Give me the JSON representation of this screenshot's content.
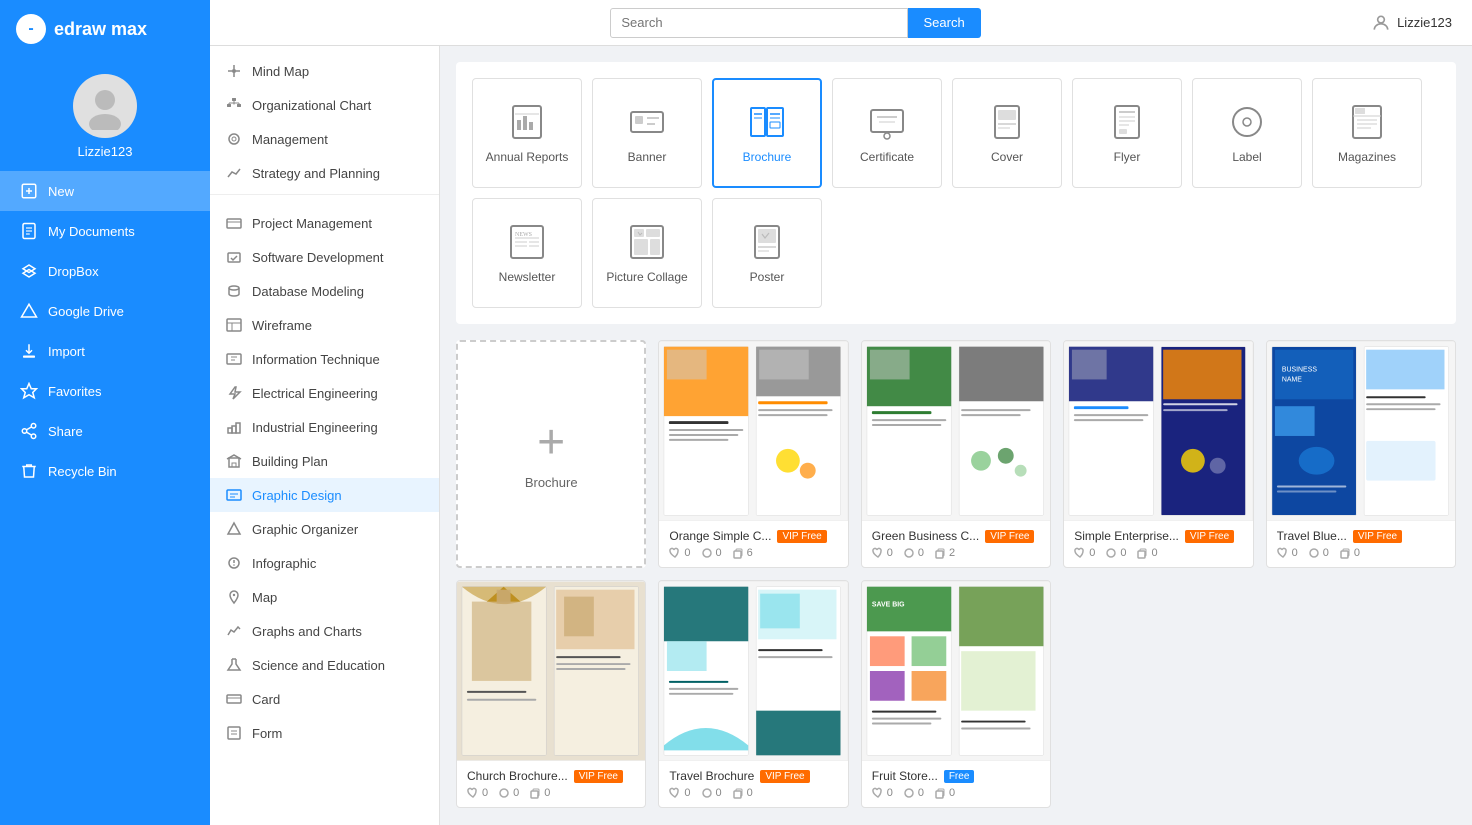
{
  "app": {
    "name": "edraw max",
    "user": "Lizzie123"
  },
  "topbar": {
    "search_placeholder": "Search",
    "search_btn": "Search"
  },
  "sidebar": {
    "items": [
      {
        "id": "new",
        "label": "New",
        "active": true
      },
      {
        "id": "my-documents",
        "label": "My Documents",
        "active": false
      },
      {
        "id": "dropbox",
        "label": "DropBox",
        "active": false
      },
      {
        "id": "google-drive",
        "label": "Google Drive",
        "active": false
      },
      {
        "id": "import",
        "label": "Import",
        "active": false
      },
      {
        "id": "favorites",
        "label": "Favorites",
        "active": false
      },
      {
        "id": "share",
        "label": "Share",
        "active": false
      },
      {
        "id": "recycle-bin",
        "label": "Recycle Bin",
        "active": false
      }
    ]
  },
  "categories": [
    {
      "id": "mind-map",
      "label": "Mind Map"
    },
    {
      "id": "org-chart",
      "label": "Organizational Chart"
    },
    {
      "id": "management",
      "label": "Management"
    },
    {
      "id": "strategy",
      "label": "Strategy and Planning"
    },
    {
      "id": "project-mgmt",
      "label": "Project Management"
    },
    {
      "id": "software-dev",
      "label": "Software Development"
    },
    {
      "id": "database",
      "label": "Database Modeling"
    },
    {
      "id": "wireframe",
      "label": "Wireframe"
    },
    {
      "id": "info-tech",
      "label": "Information Technique"
    },
    {
      "id": "electrical",
      "label": "Electrical Engineering"
    },
    {
      "id": "industrial",
      "label": "Industrial Engineering"
    },
    {
      "id": "building",
      "label": "Building Plan"
    },
    {
      "id": "graphic-design",
      "label": "Graphic Design",
      "active": true
    },
    {
      "id": "graphic-org",
      "label": "Graphic Organizer"
    },
    {
      "id": "infographic",
      "label": "Infographic"
    },
    {
      "id": "map",
      "label": "Map"
    },
    {
      "id": "graphs-charts",
      "label": "Graphs and Charts"
    },
    {
      "id": "science-edu",
      "label": "Science and Education"
    },
    {
      "id": "card",
      "label": "Card"
    },
    {
      "id": "form",
      "label": "Form"
    }
  ],
  "type_cards": [
    {
      "id": "annual-reports",
      "label": "Annual Reports",
      "selected": false
    },
    {
      "id": "banner",
      "label": "Banner",
      "selected": false
    },
    {
      "id": "brochure",
      "label": "Brochure",
      "selected": true
    },
    {
      "id": "certificate",
      "label": "Certificate",
      "selected": false
    },
    {
      "id": "cover",
      "label": "Cover",
      "selected": false
    },
    {
      "id": "flyer",
      "label": "Flyer",
      "selected": false
    },
    {
      "id": "label",
      "label": "Label",
      "selected": false
    },
    {
      "id": "magazines",
      "label": "Magazines",
      "selected": false
    },
    {
      "id": "newsletter",
      "label": "Newsletter",
      "selected": false
    },
    {
      "id": "picture-collage",
      "label": "Picture Collage",
      "selected": false
    },
    {
      "id": "poster",
      "label": "Poster",
      "selected": false
    }
  ],
  "templates": [
    {
      "id": "new",
      "type": "new",
      "label": "Brochure"
    },
    {
      "id": "t1",
      "name": "Orange Simple C...",
      "badge": "VIP Free",
      "likes": 0,
      "hearts": 0,
      "copies": 6,
      "color": "orange"
    },
    {
      "id": "t2",
      "name": "Green Business C...",
      "badge": "VIP Free",
      "likes": 0,
      "hearts": 0,
      "copies": 2,
      "color": "green"
    },
    {
      "id": "t3",
      "name": "Simple Enterprise...",
      "badge": "VIP Free",
      "likes": 0,
      "hearts": 0,
      "copies": 0,
      "color": "darkblue"
    },
    {
      "id": "t4",
      "name": "Travel Brochure",
      "badge": "VIP Free",
      "likes": 0,
      "hearts": 0,
      "copies": 0,
      "color": "teal"
    },
    {
      "id": "t5",
      "name": "Church Brochure",
      "badge": "VIP Free",
      "likes": 0,
      "hearts": 0,
      "copies": 0,
      "color": "gold"
    },
    {
      "id": "t6",
      "name": "Fruit Store...",
      "badge": "Free",
      "likes": 0,
      "hearts": 0,
      "copies": 0,
      "color": "fruit"
    },
    {
      "id": "t7",
      "name": "Travel Blue...",
      "badge": "VIP Free",
      "likes": 0,
      "hearts": 0,
      "copies": 0,
      "color": "blue2"
    }
  ]
}
